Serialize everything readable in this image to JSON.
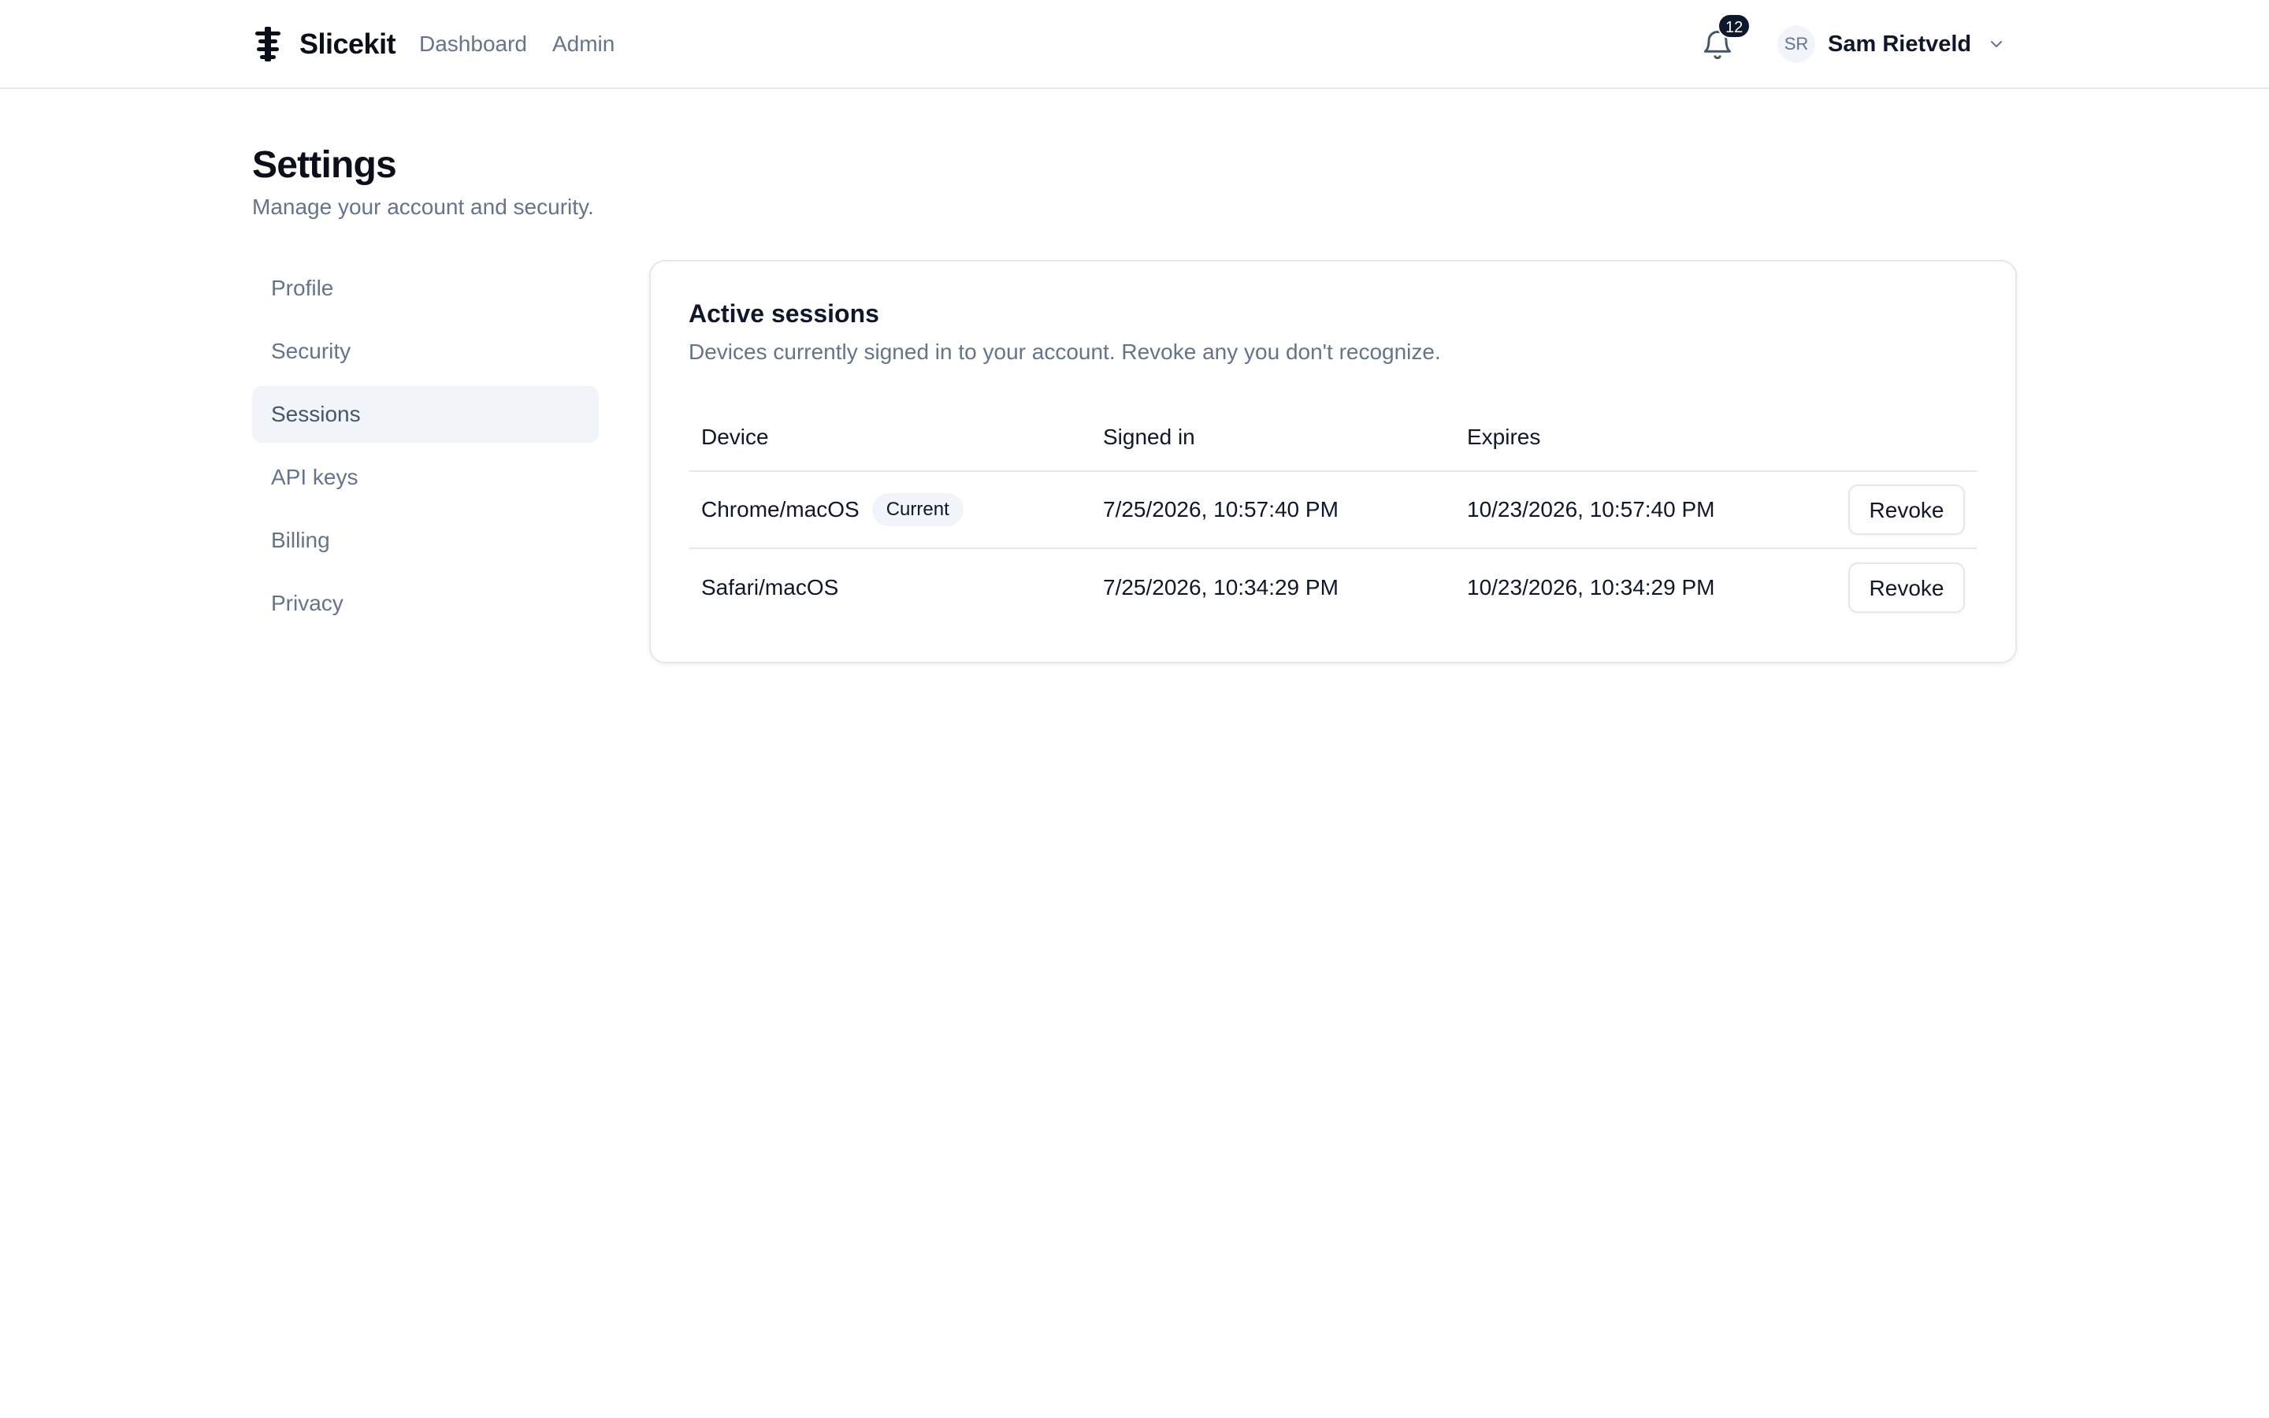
{
  "app": {
    "name": "Slicekit"
  },
  "topnav": {
    "items": [
      {
        "label": "Dashboard"
      },
      {
        "label": "Admin"
      }
    ]
  },
  "notifications": {
    "count": "12",
    "icon": "bell-icon"
  },
  "user": {
    "initials": "SR",
    "name": "Sam Rietveld",
    "menu_icon": "chevron-down-icon"
  },
  "page": {
    "title": "Settings",
    "subtitle": "Manage your account and security."
  },
  "sidenav": {
    "active": "Sessions",
    "items": [
      {
        "label": "Profile"
      },
      {
        "label": "Security"
      },
      {
        "label": "Sessions"
      },
      {
        "label": "API keys"
      },
      {
        "label": "Billing"
      },
      {
        "label": "Privacy"
      }
    ]
  },
  "sessions_card": {
    "title": "Active sessions",
    "description": "Devices currently signed in to your account. Revoke any you don't recognize.",
    "columns": [
      "Device",
      "Signed in",
      "Expires",
      ""
    ],
    "rows": [
      {
        "device": "Chrome/macOS",
        "badge": "Current",
        "signed_in": "7/25/2026, 10:57:40 PM",
        "expires": "10/23/2026, 10:57:40 PM",
        "action": "Revoke"
      },
      {
        "device": "Safari/macOS",
        "badge": "",
        "signed_in": "7/25/2026, 10:34:29 PM",
        "expires": "10/23/2026, 10:34:29 PM",
        "action": "Revoke"
      }
    ]
  },
  "colors": {
    "text_primary": "#0f172a",
    "text_muted": "#64748b",
    "active_nav_bg": "#f1f5f9",
    "border": "#e5e7eb",
    "badge_bg": "#0f172a"
  }
}
